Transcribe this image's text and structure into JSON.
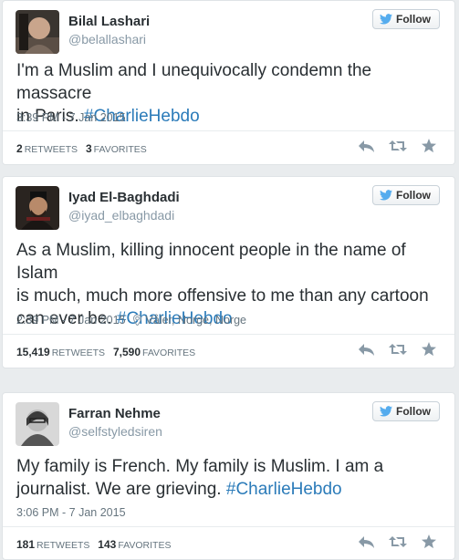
{
  "follow_label": "Follow",
  "tweets": [
    {
      "name": "Bilal Lashari",
      "handle": "@belallashari",
      "text_lines": [
        {
          "plain": "I'm a Muslim and I unequivocally condemn the massacre",
          "tag": ""
        },
        {
          "plain": "in Paris. ",
          "tag": "#CharlieHebdo"
        }
      ],
      "time": "3:39 PM - 7 Jan 2015",
      "location": "",
      "retweets": "2",
      "retweets_label": "RETWEETS",
      "favorites": "3",
      "favorites_label": "FAVORITES"
    },
    {
      "name": "Iyad El-Baghdadi",
      "handle": "@iyad_elbaghdadi",
      "text_lines": [
        {
          "plain": "As a Muslim, killing innocent people in the name of Islam",
          "tag": ""
        },
        {
          "plain": "is much, much more offensive to me than any cartoon",
          "tag": ""
        },
        {
          "plain": "can ever be. ",
          "tag": "#CharlieHebdo"
        }
      ],
      "time": "2:39 PM - 7 Jan 2015",
      "location": "Våler, Norge, Norge",
      "retweets": "15,419",
      "retweets_label": "RETWEETS",
      "favorites": "7,590",
      "favorites_label": "FAVORITES"
    },
    {
      "name": "Farran Nehme",
      "handle": "@selfstyledsiren",
      "text_lines": [
        {
          "plain": "My family is French. My family is Muslim. I am a",
          "tag": ""
        },
        {
          "plain": "journalist. We are grieving. ",
          "tag": "#CharlieHebdo"
        }
      ],
      "time": "3:06 PM - 7 Jan 2015",
      "location": "",
      "retweets": "181",
      "retweets_label": "RETWEETS",
      "favorites": "143",
      "favorites_label": "FAVORITES"
    }
  ],
  "icons": [
    "twitter-bird-icon",
    "reply-icon",
    "retweet-icon",
    "favorite-star-icon",
    "location-pin-icon"
  ],
  "colors": {
    "hashtag": "#2b7bb9",
    "meta": "#66757f",
    "handle": "#8899a6",
    "background": "#e9ecee"
  }
}
